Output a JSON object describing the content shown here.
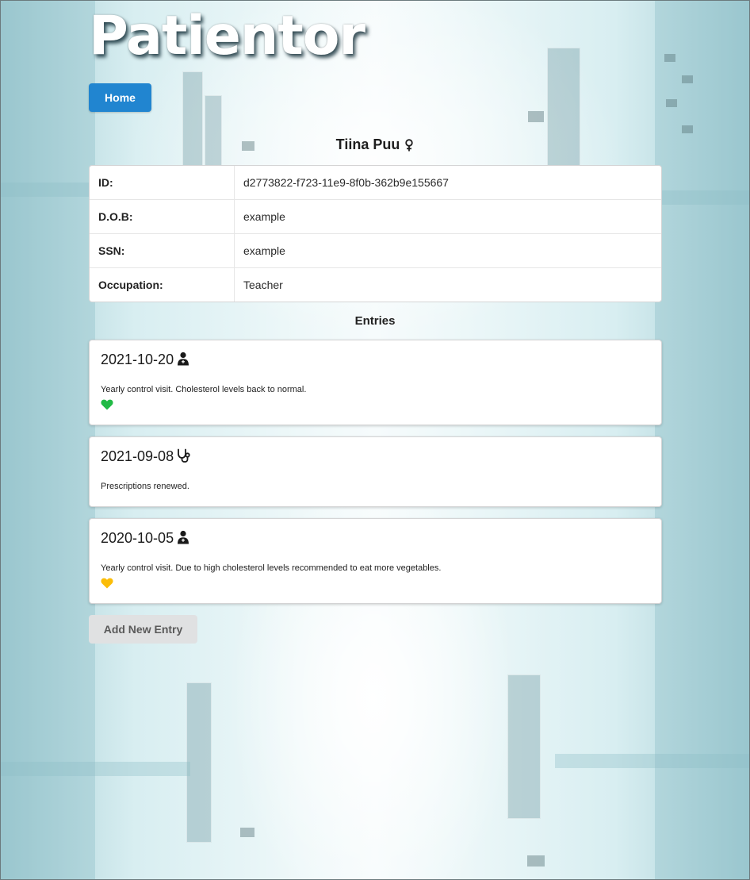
{
  "app": {
    "title": "Patientor"
  },
  "nav": {
    "home_label": "Home"
  },
  "patient": {
    "name": "Tiina Puu",
    "gender_icon": "female-icon",
    "fields": [
      {
        "label": "ID:",
        "value": "d2773822-f723-11e9-8f0b-362b9e155667"
      },
      {
        "label": "D.O.B:",
        "value": "example"
      },
      {
        "label": "SSN:",
        "value": "example"
      },
      {
        "label": "Occupation:",
        "value": "Teacher"
      }
    ]
  },
  "entries": {
    "heading": "Entries",
    "items": [
      {
        "date": "2021-10-20",
        "type_icon": "doctor-icon",
        "description": "Yearly control visit. Cholesterol levels back to normal.",
        "health_icon": "heart-icon",
        "health_color": "#21ba45"
      },
      {
        "date": "2021-09-08",
        "type_icon": "stethoscope-icon",
        "description": "Prescriptions renewed."
      },
      {
        "date": "2020-10-05",
        "type_icon": "doctor-icon",
        "description": "Yearly control visit. Due to high cholesterol levels recommended to eat more vegetables.",
        "health_icon": "heart-icon",
        "health_color": "#fbbd08"
      }
    ]
  },
  "actions": {
    "add_entry_label": "Add New Entry"
  },
  "colors": {
    "primary": "#2185d0",
    "secondary": "#e0e1e2"
  }
}
